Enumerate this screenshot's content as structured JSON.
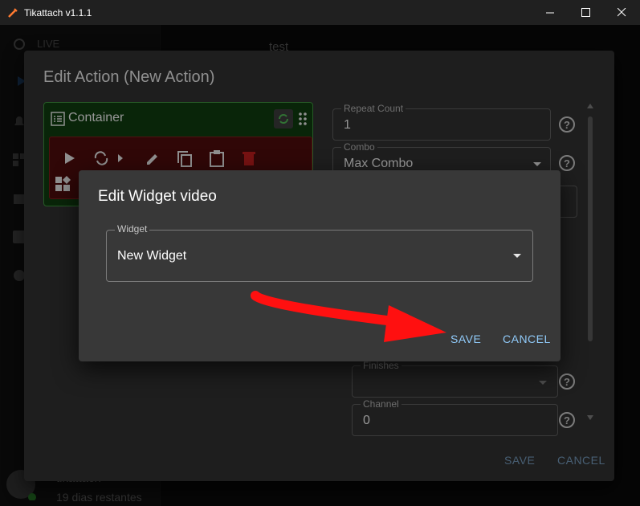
{
  "window": {
    "title": "Tikattach v1.1.1",
    "minimize_glyph": "—",
    "maximize_glyph": "☐",
    "close_glyph": "✕"
  },
  "background": {
    "sidebar_live": "LIVE",
    "action_name": "test",
    "user_name": "tikattach",
    "user_days": "19 dias restantes"
  },
  "edit_action": {
    "title": "Edit Action (New Action)",
    "container_label": "Container",
    "repeat_count": {
      "label": "Repeat Count",
      "value": "1"
    },
    "combo": {
      "label": "Combo",
      "value": "Max Combo"
    },
    "finishes": {
      "label": "Finishes",
      "value": ""
    },
    "channel": {
      "label": "Channel",
      "value": "0"
    },
    "help_glyph": "?",
    "save_label": "SAVE",
    "cancel_label": "CANCEL"
  },
  "edit_widget": {
    "title": "Edit Widget video",
    "widget_field": {
      "label": "Widget",
      "value": "New Widget"
    },
    "save_label": "SAVE",
    "cancel_label": "CANCEL"
  },
  "colors": {
    "container_bg": "#0f3a0f",
    "inner_card_bg": "#4a0b0b",
    "accent_button": "#90caf9",
    "annotation_arrow": "#ff1010"
  }
}
